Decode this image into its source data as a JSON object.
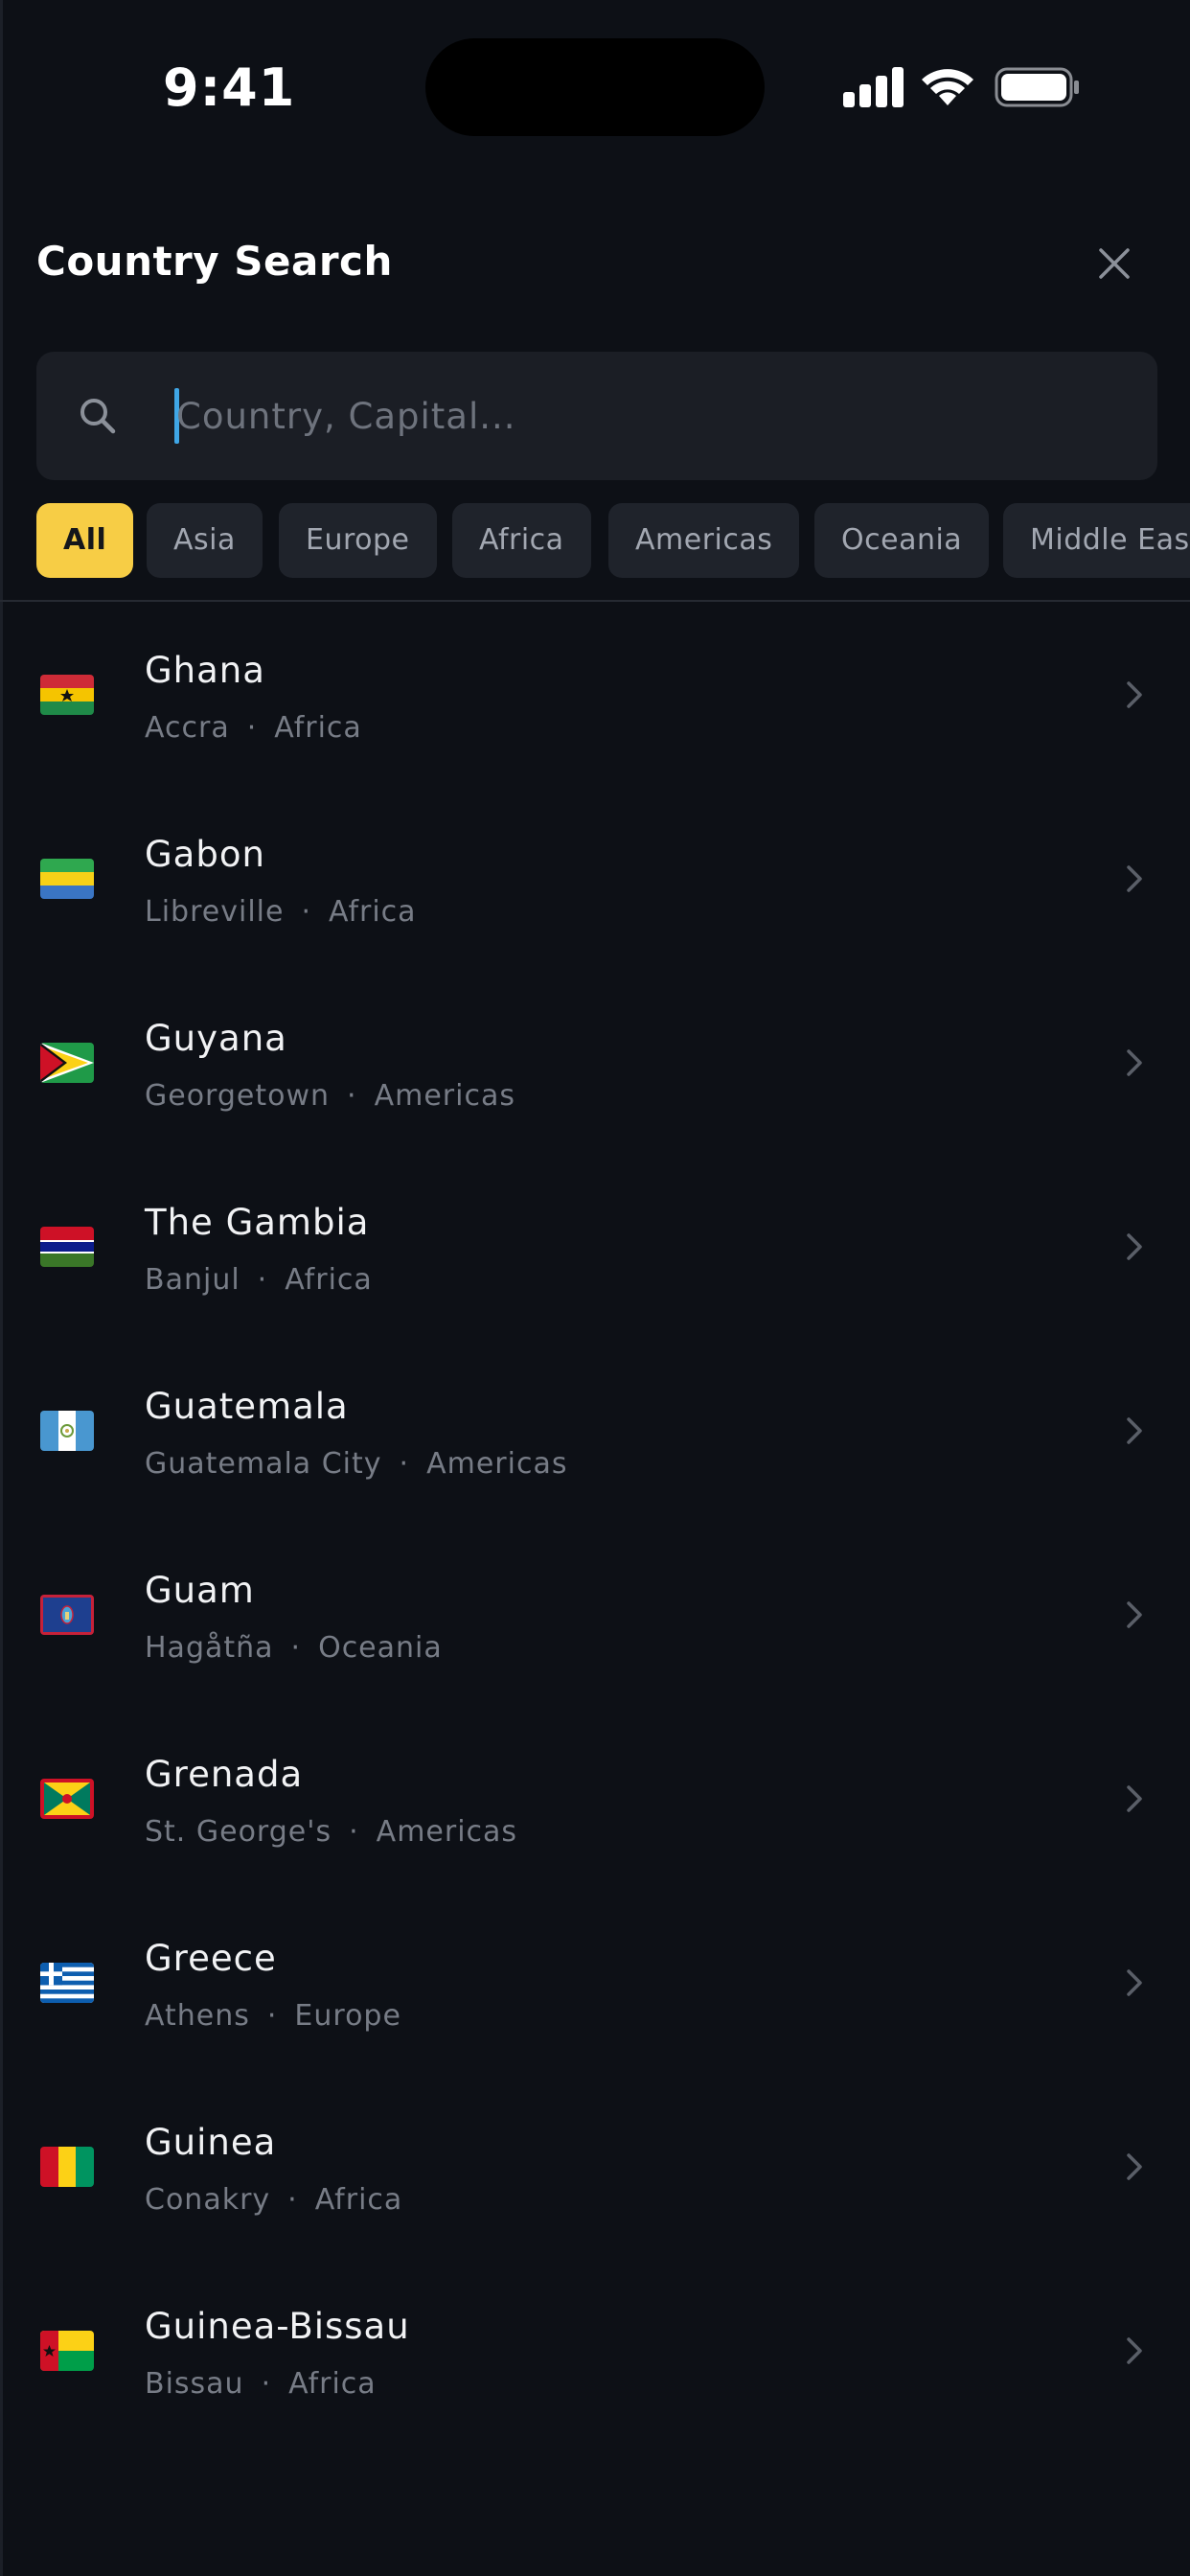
{
  "status_bar": {
    "time": "9:41"
  },
  "header": {
    "title": "Country Search",
    "close_icon": "close-icon"
  },
  "search": {
    "value": "",
    "placeholder": "Country, Capital...",
    "icon": "search-icon"
  },
  "filters": {
    "selected": "All",
    "chips": [
      "All",
      "Asia",
      "Europe",
      "Africa",
      "Americas",
      "Oceania",
      "Middle East"
    ]
  },
  "countries": [
    {
      "name": "Ghana",
      "capital": "Accra",
      "region": "Africa",
      "flag": "ghana-flag"
    },
    {
      "name": "Gabon",
      "capital": "Libreville",
      "region": "Africa",
      "flag": "gabon-flag"
    },
    {
      "name": "Guyana",
      "capital": "Georgetown",
      "region": "Americas",
      "flag": "guyana-flag"
    },
    {
      "name": "The Gambia",
      "capital": "Banjul",
      "region": "Africa",
      "flag": "gambia-flag"
    },
    {
      "name": "Guatemala",
      "capital": "Guatemala City",
      "region": "Americas",
      "flag": "guatemala-flag"
    },
    {
      "name": "Guam",
      "capital": "Hagåtña",
      "region": "Oceania",
      "flag": "guam-flag"
    },
    {
      "name": "Grenada",
      "capital": "St. George's",
      "region": "Americas",
      "flag": "grenada-flag"
    },
    {
      "name": "Greece",
      "capital": "Athens",
      "region": "Europe",
      "flag": "greece-flag"
    },
    {
      "name": "Guinea",
      "capital": "Conakry",
      "region": "Africa",
      "flag": "guinea-flag"
    },
    {
      "name": "Guinea-Bissau",
      "capital": "Bissau",
      "region": "Africa",
      "flag": "guinea-bissau-flag"
    }
  ],
  "colors": {
    "background": "#0d1016",
    "search_background": "#1b1e25",
    "chip_background": "#1f232b",
    "chip_active": "#f7cd45",
    "caret": "#3fa6e6"
  }
}
